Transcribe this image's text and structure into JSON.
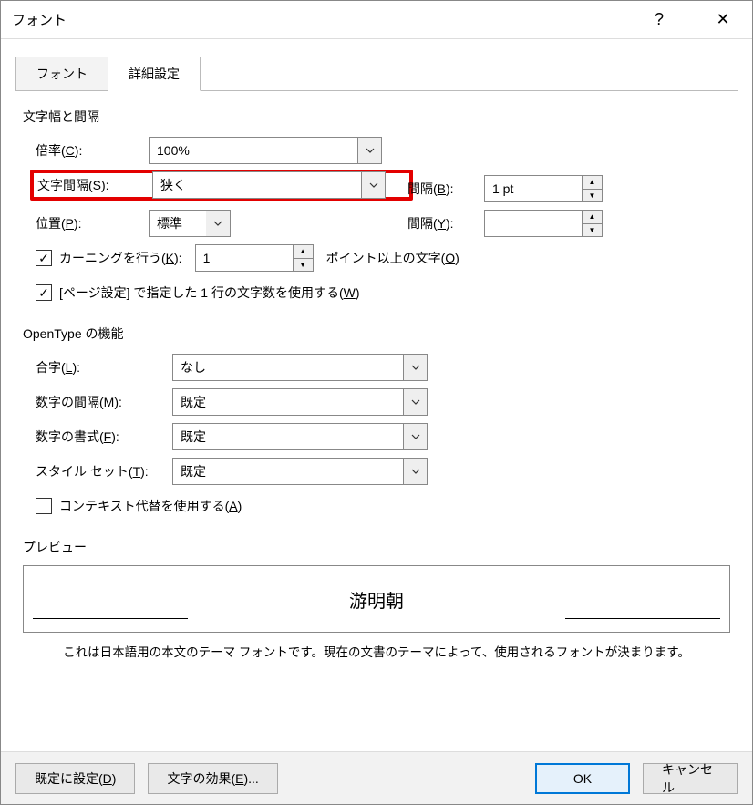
{
  "title": "フォント",
  "help": "?",
  "close": "✕",
  "tabs": {
    "font": "フォント",
    "advanced": "詳細設定"
  },
  "spacing_group": {
    "label": "文字幅と間隔",
    "scale_label": "倍率(C):",
    "scale_value": "100%",
    "spacing_label": "文字間隔(S):",
    "spacing_value": "狭く",
    "by_label": "間隔(B):",
    "by_value": "1 pt",
    "position_label": "位置(P):",
    "position_value": "標準",
    "by2_label": "間隔(Y):",
    "by2_value": "",
    "kerning_label": "カーニングを行う(K):",
    "kerning_value": "1",
    "kerning_tail": "ポイント以上の文字(O)",
    "grid_label": "[ページ設定] で指定した 1 行の文字数を使用する(W)"
  },
  "opentype_group": {
    "label": "OpenType の機能",
    "ligatures_label": "合字(L):",
    "ligatures_value": "なし",
    "numspacing_label": "数字の間隔(M):",
    "numspacing_value": "既定",
    "numforms_label": "数字の書式(F):",
    "numforms_value": "既定",
    "styleset_label": "スタイル セット(T):",
    "styleset_value": "既定",
    "contextual_label": "コンテキスト代替を使用する(A)"
  },
  "preview": {
    "label": "プレビュー",
    "text": "游明朝",
    "note": "これは日本語用の本文のテーマ フォントです。現在の文書のテーマによって、使用されるフォントが決まります。"
  },
  "buttons": {
    "setdefault": "既定に設定(D)",
    "texteffects": "文字の効果(E)...",
    "ok": "OK",
    "cancel": "キャンセル"
  }
}
